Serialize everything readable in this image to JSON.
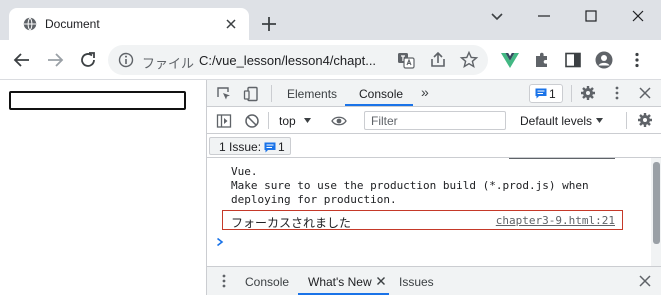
{
  "browser": {
    "tab_title": "Document",
    "omnibox": {
      "security_label": "ファイル",
      "url": "C:/vue_lesson/lesson4/chapt..."
    }
  },
  "devtools": {
    "tabs": [
      "Elements",
      "Console"
    ],
    "active_tab": "Console",
    "issues_badge_count": "1",
    "console_toolbar": {
      "context": "top",
      "filter_placeholder": "Filter",
      "levels": "Default levels"
    },
    "issues_chip": {
      "label": "1 Issue:",
      "count": "1"
    },
    "console_lines": [
      "Vue.",
      "Make sure to use the production build (*.prod.js) when",
      "deploying for production."
    ],
    "message": {
      "text": "フォーカスされました",
      "source": "chapter3-9.html:21"
    },
    "drawer_tabs": [
      "Console",
      "What's New",
      "Issues"
    ],
    "active_drawer_tab": "What's New"
  },
  "colors": {
    "accent": "#1a73e8",
    "message_border": "#c53929",
    "vue_green": "#42b883"
  }
}
